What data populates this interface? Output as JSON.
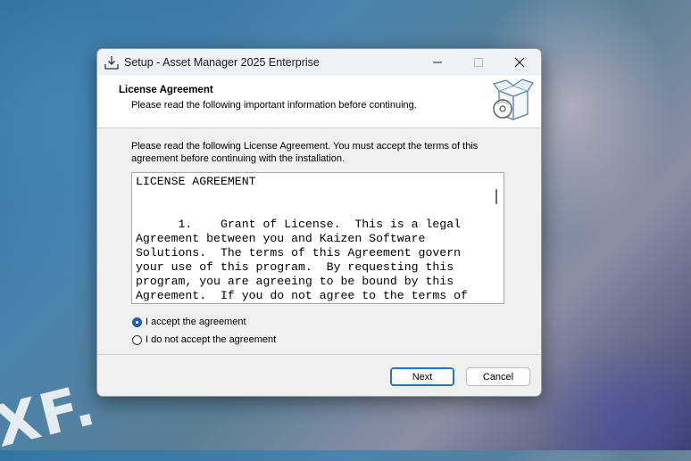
{
  "wallpaper": {
    "text": "XF."
  },
  "window": {
    "title": "Setup - Asset Manager 2025 Enterprise",
    "icons": {
      "app": "setup-download-icon",
      "minimize": "minimize-icon",
      "maximize": "maximize-icon",
      "close": "close-icon"
    }
  },
  "header": {
    "title": "License Agreement",
    "subtitle": "Please read the following important information before continuing.",
    "image": "software-box-icon"
  },
  "instructions": "Please read the following License Agreement. You must accept the terms of this agreement before continuing with the installation.",
  "license": {
    "text": "LICENSE AGREEMENT\n\n\n      1.    Grant of License.  This is a legal Agreement between you and Kaizen Software Solutions.  The terms of this Agreement govern your use of this program.  By requesting this program, you are agreeing to be bound by this Agreement.  If you do not agree to the terms of"
  },
  "options": {
    "accept": {
      "label": "I accept the agreement",
      "selected": true
    },
    "decline": {
      "label": "I do not accept the agreement",
      "selected": false
    }
  },
  "buttons": {
    "next": "Next",
    "cancel": "Cancel"
  },
  "colors": {
    "accent": "#1f5fae",
    "header_bg": "#ffffff",
    "dialog_bg": "#f0f0f0"
  }
}
